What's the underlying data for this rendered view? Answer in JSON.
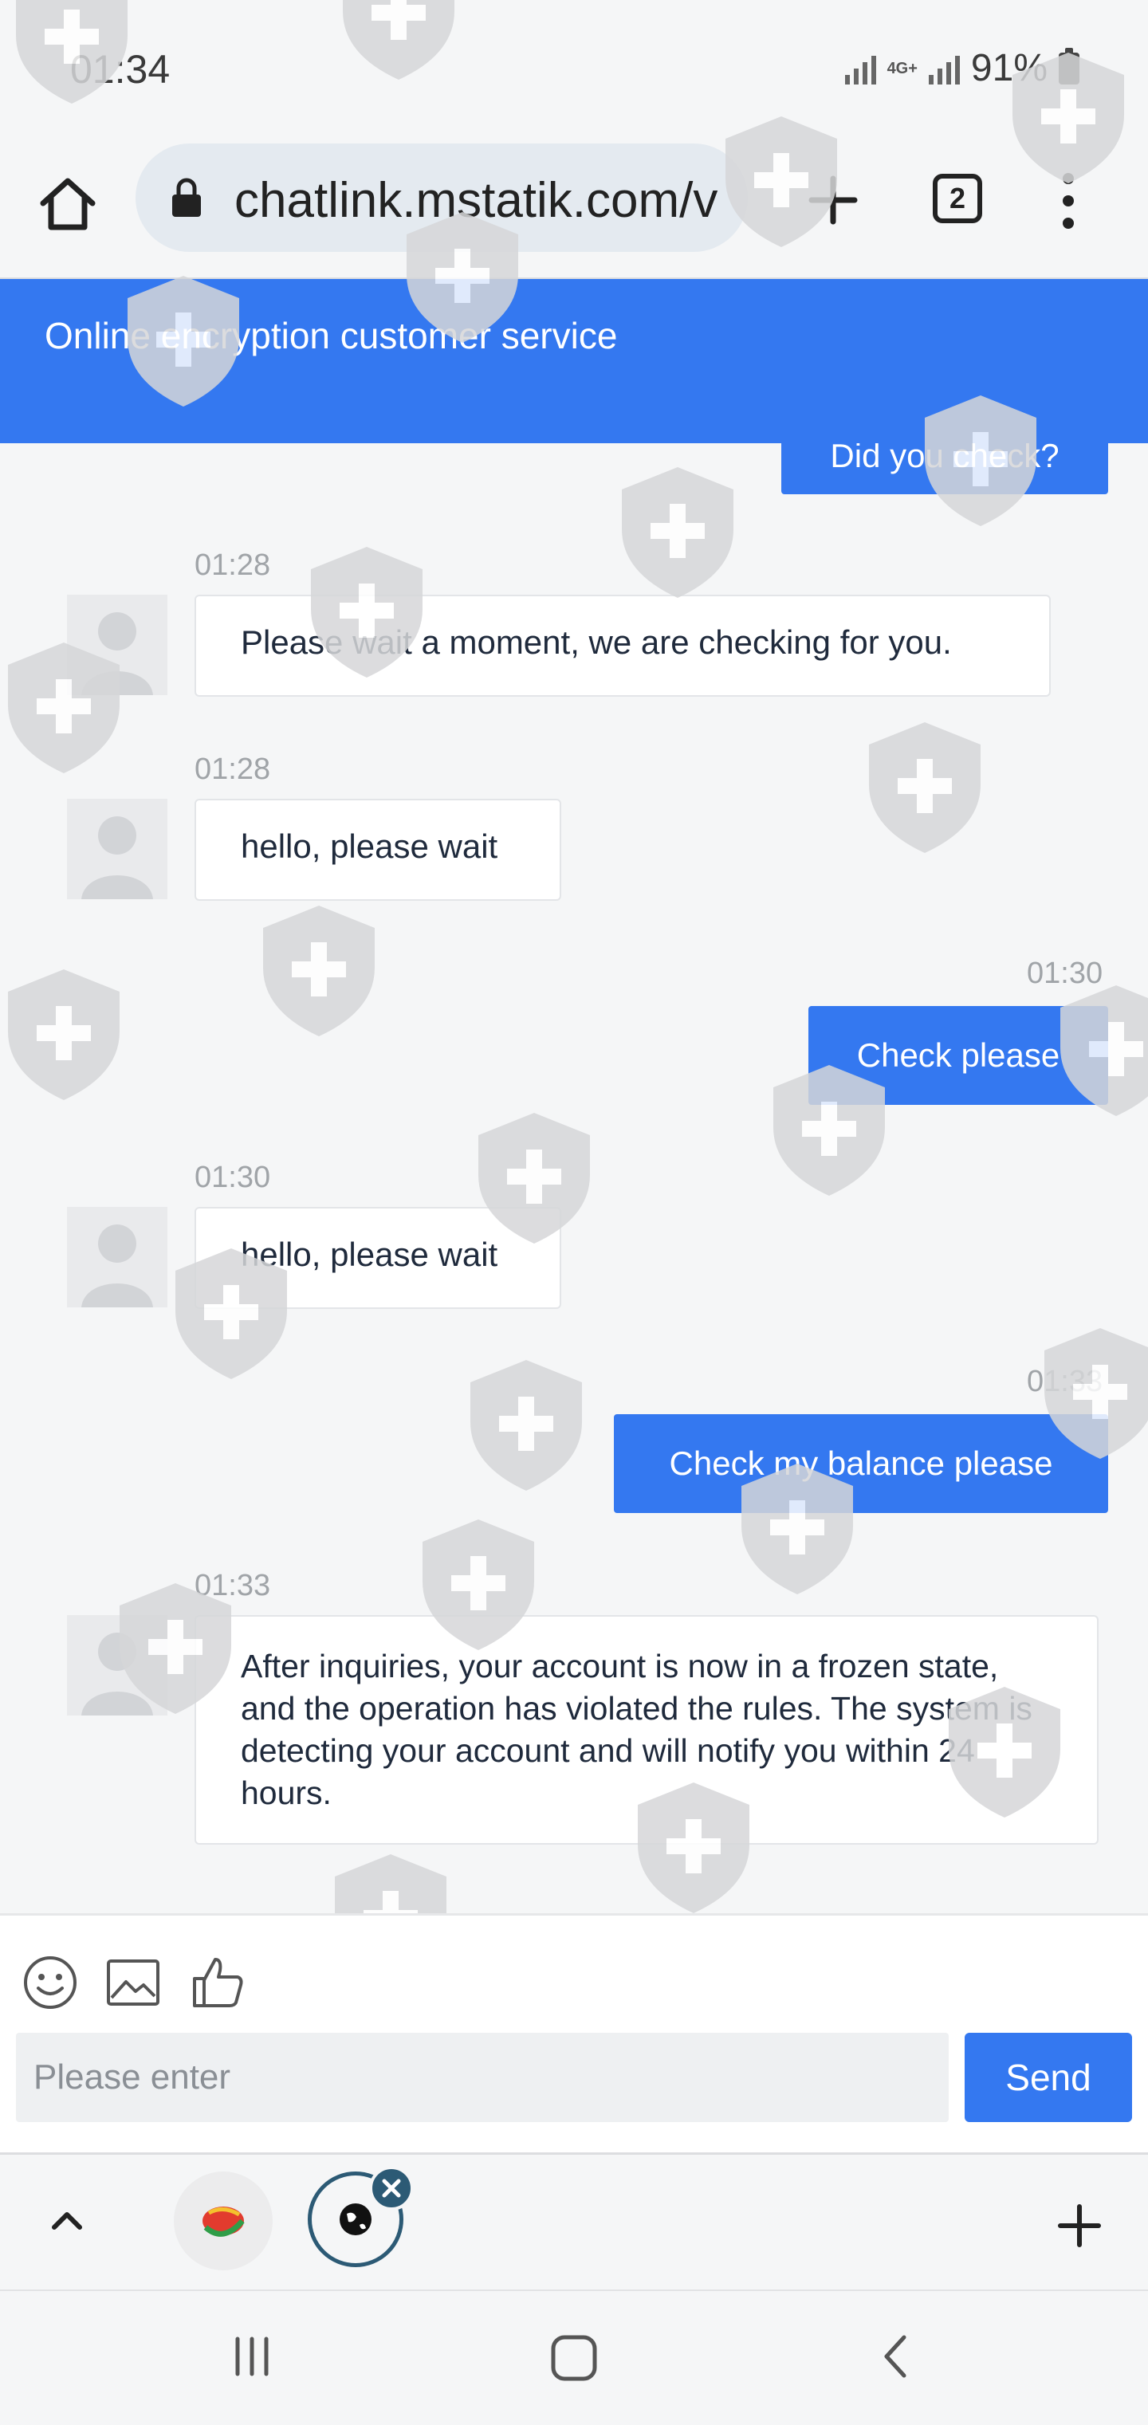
{
  "status_bar": {
    "time": "01:34",
    "network": "4G+",
    "battery": "91%"
  },
  "browser": {
    "url": "chatlink.mstatik.com/v",
    "tab_count": "2"
  },
  "chat": {
    "title": "Online encryption customer service",
    "partial_top_message": "Did you check?",
    "messages": [
      {
        "time": "01:28",
        "text": "Please wait a moment, we are checking for you."
      },
      {
        "time": "01:28",
        "text": "hello, please wait"
      },
      {
        "time": "01:30",
        "text": "Check please"
      },
      {
        "time": "01:30",
        "text": "hello, please wait"
      },
      {
        "time": "01:33",
        "text": "Check my balance please"
      },
      {
        "time": "01:33",
        "text": "After inquiries, your account is now in a frozen state, and the operation has violated the rules. The system is detecting your account and will notify you within 24 hours."
      }
    ]
  },
  "input": {
    "placeholder": "Please enter",
    "send_label": "Send"
  },
  "icons": {
    "home": "home-icon",
    "lock": "lock-icon",
    "new_tab": "plus-icon",
    "menu": "more-vert-icon",
    "emoji": "emoji-icon",
    "image": "image-icon",
    "like": "thumbs-up-icon",
    "collapse": "chevron-up-icon",
    "nav_recents": "recents-icon",
    "nav_home": "nav-home-icon",
    "nav_back": "back-icon"
  },
  "colors": {
    "accent": "#3478f0",
    "watermark": "#d6d7d9"
  }
}
